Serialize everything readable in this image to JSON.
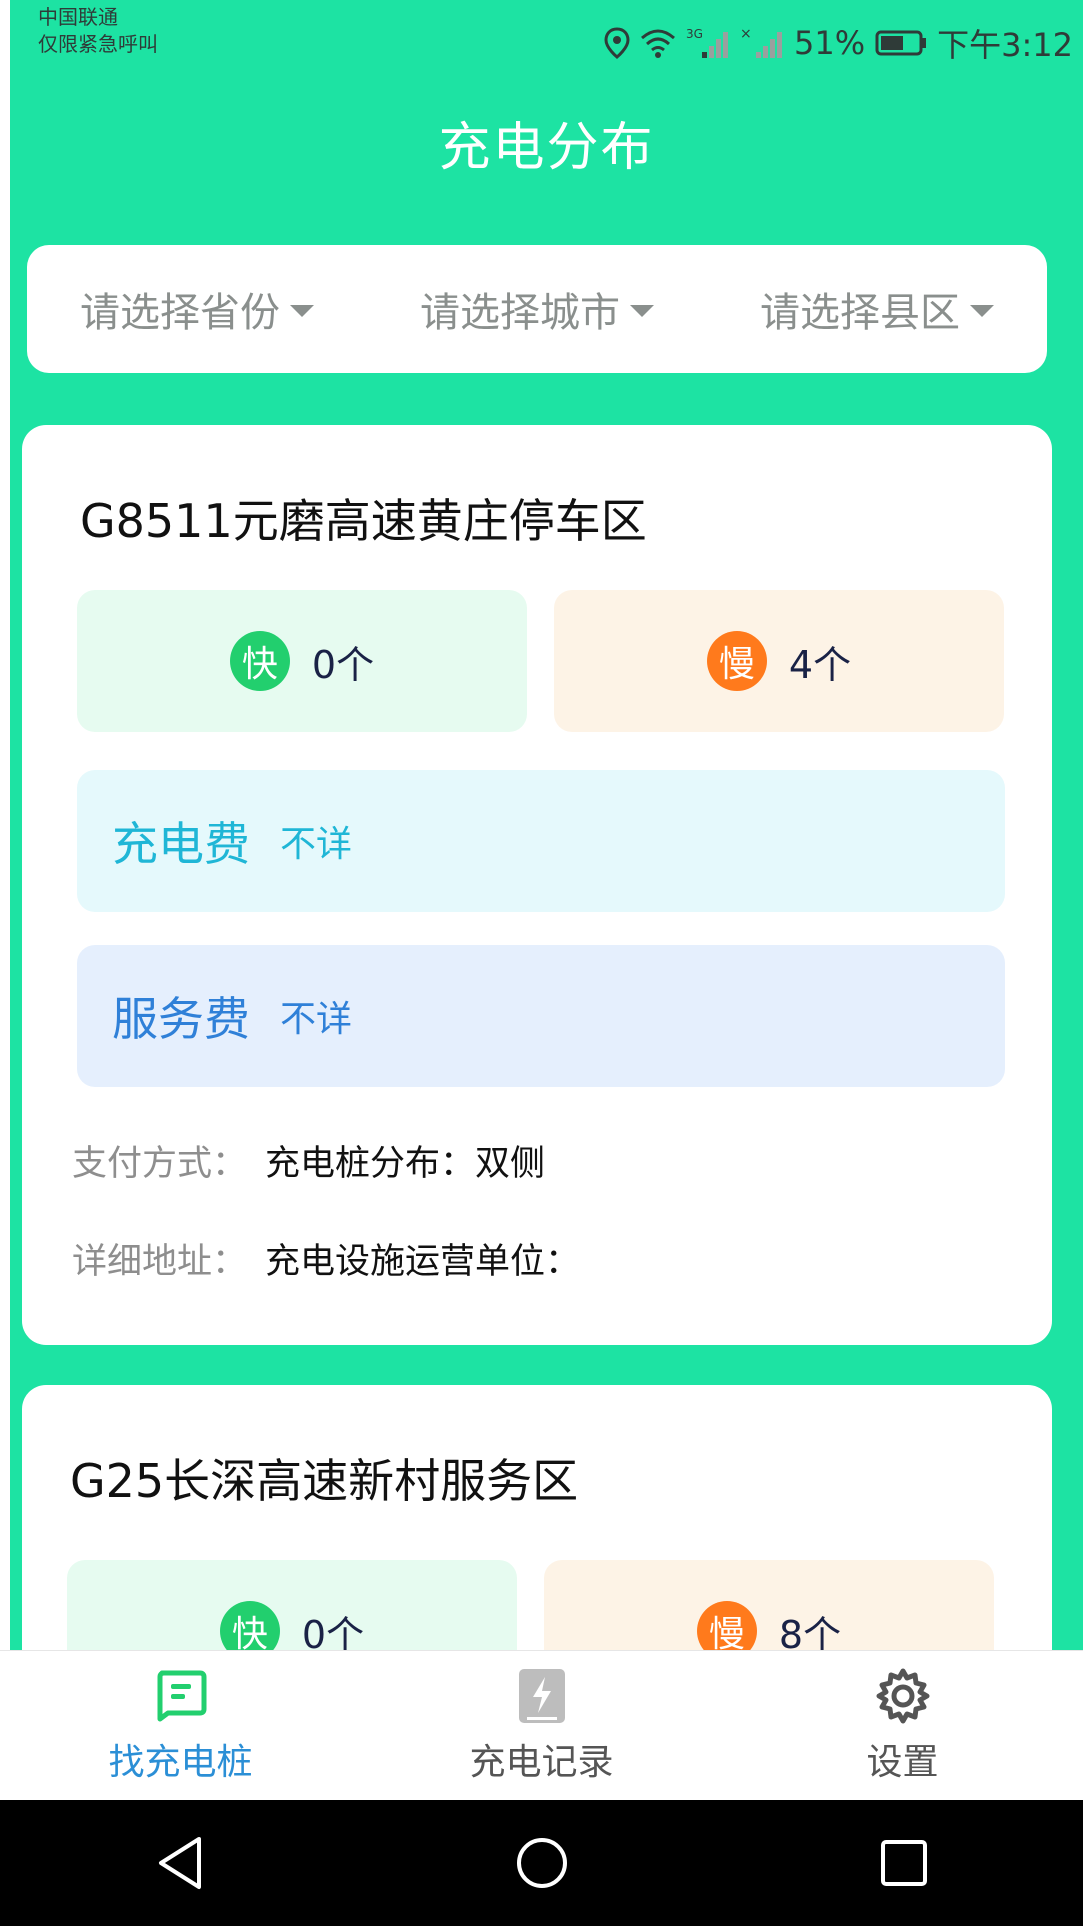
{
  "status_bar": {
    "carrier_line1": "中国联通",
    "carrier_line2": "仅限紧急呼叫",
    "battery_percent": "51%",
    "time": "下午3:12",
    "icons": [
      "location-icon",
      "wifi-icon",
      "signal-3g-icon",
      "signal-no-sim-icon",
      "battery-icon"
    ]
  },
  "header": {
    "title": "充电分布"
  },
  "filters": {
    "province": "请选择省份",
    "city": "请选择城市",
    "district": "请选择县区"
  },
  "stations": [
    {
      "name": "G8511元磨高速黄庄停车区",
      "fast_badge": "快",
      "fast_count": "0个",
      "slow_badge": "慢",
      "slow_count": "4个",
      "charge_fee_label": "充电费",
      "charge_fee_value": "不详",
      "service_fee_label": "服务费",
      "service_fee_value": "不详",
      "payment_label": "支付方式：",
      "distribution_label": "充电桩分布：",
      "distribution_value": "双侧",
      "address_label": "详细地址：",
      "operator_label": "充电设施运营单位："
    },
    {
      "name": "G25长深高速新村服务区",
      "fast_badge": "快",
      "fast_count": "0个",
      "slow_badge": "慢",
      "slow_count": "8个"
    }
  ],
  "bottom_nav": [
    {
      "label": "找充电桩",
      "icon": "charger-list-icon",
      "active": true
    },
    {
      "label": "充电记录",
      "icon": "charge-record-icon",
      "active": false
    },
    {
      "label": "设置",
      "icon": "gear-icon",
      "active": false
    }
  ],
  "colors": {
    "primary_green": "#1de3a3",
    "active_tab": "#2b8fd6",
    "fast": "#22cf6e",
    "slow": "#ff7a1c"
  }
}
